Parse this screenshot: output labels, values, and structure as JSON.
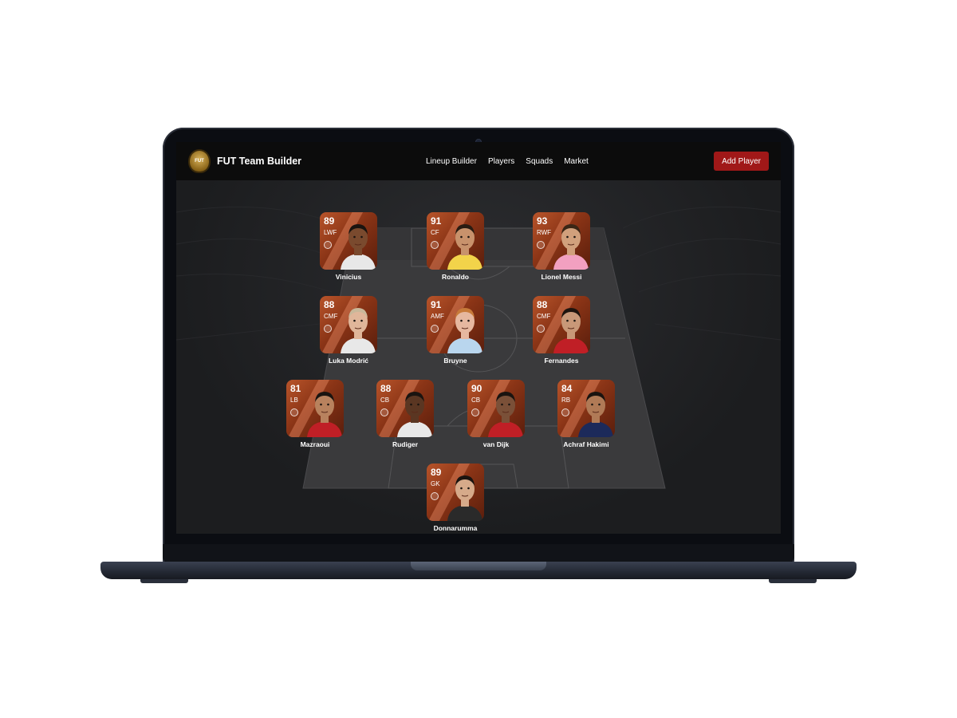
{
  "app": {
    "name": "FUT Team Builder",
    "logo_text": "FUT"
  },
  "nav": {
    "links": [
      "Lineup Builder",
      "Players",
      "Squads",
      "Market"
    ],
    "cta": "Add Player"
  },
  "colors": {
    "accent": "#a01818",
    "card": "#a0441e",
    "navbar": "#0c0c0c",
    "background": "#1e1f21"
  },
  "players": [
    {
      "name": "Vinicius",
      "rating": "89",
      "position": "LWF",
      "skin": "#7a4a2e",
      "hair": "#1a1410",
      "shirt": "#e8e8e8"
    },
    {
      "name": "Ronaldo",
      "rating": "91",
      "position": "CF",
      "skin": "#c8926c",
      "hair": "#2a1c12",
      "shirt": "#f2d34a"
    },
    {
      "name": "Lionel Messi",
      "rating": "93",
      "position": "RWF",
      "skin": "#d1a07c",
      "hair": "#3a2616",
      "shirt": "#f2a0c0"
    },
    {
      "name": "Luka Modrić",
      "rating": "88",
      "position": "CMF",
      "skin": "#e0b69a",
      "hair": "#c9b89a",
      "shirt": "#e8e8e8"
    },
    {
      "name": "Bruyne",
      "rating": "91",
      "position": "AMF",
      "skin": "#e6b8a0",
      "hair": "#c77a3a",
      "shirt": "#b9d6ee"
    },
    {
      "name": "Fernandes",
      "rating": "88",
      "position": "CMF",
      "skin": "#c89878",
      "hair": "#1e140e",
      "shirt": "#c01f26"
    },
    {
      "name": "Mazraoui",
      "rating": "81",
      "position": "LB",
      "skin": "#b8825e",
      "hair": "#1a1410",
      "shirt": "#c01f26"
    },
    {
      "name": "Rudiger",
      "rating": "88",
      "position": "CB",
      "skin": "#5a3622",
      "hair": "#1a1410",
      "shirt": "#e8e8e8"
    },
    {
      "name": "van Dijk",
      "rating": "90",
      "position": "CB",
      "skin": "#7a5038",
      "hair": "#1a1410",
      "shirt": "#c01f26"
    },
    {
      "name": "Achraf Hakimi",
      "rating": "84",
      "position": "RB",
      "skin": "#b07a56",
      "hair": "#1a1410",
      "shirt": "#1c2a5a"
    },
    {
      "name": "Donnarumma",
      "rating": "89",
      "position": "GK",
      "skin": "#d6aa8a",
      "hair": "#1a1410",
      "shirt": "#2a2a2a"
    }
  ]
}
